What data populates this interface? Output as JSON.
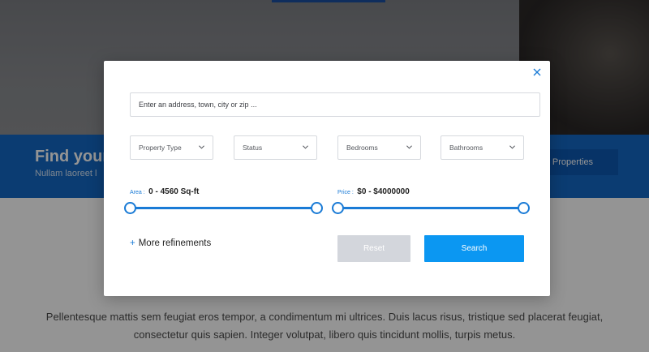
{
  "background": {
    "band_title": "Find your",
    "band_subtitle": "Nullam laoreet l",
    "band_button": "Properties",
    "body_text": "Pellentesque mattis sem feugiat eros tempor, a condimentum mi ultrices. Duis lacus risus, tristique sed placerat feugiat, consectetur quis sapien. Integer volutpat, libero quis tincidunt mollis, turpis metus."
  },
  "modal": {
    "close_icon": "close-icon",
    "address_placeholder": "Enter an address, town, city or zip ...",
    "selects": [
      {
        "label": "Property Type"
      },
      {
        "label": "Status"
      },
      {
        "label": "Bedrooms"
      },
      {
        "label": "Bathrooms"
      }
    ],
    "area": {
      "label": "Area :",
      "value": "0 - 4560 Sq-ft"
    },
    "price": {
      "label": "Price :",
      "value": "$0 - $4000000"
    },
    "refinements": {
      "icon": "+",
      "label": "More refinements"
    },
    "reset_label": "Reset",
    "search_label": "Search",
    "colors": {
      "accent": "#1a7bd6",
      "search": "#0b97f2",
      "reset": "#d3d6dc"
    }
  }
}
